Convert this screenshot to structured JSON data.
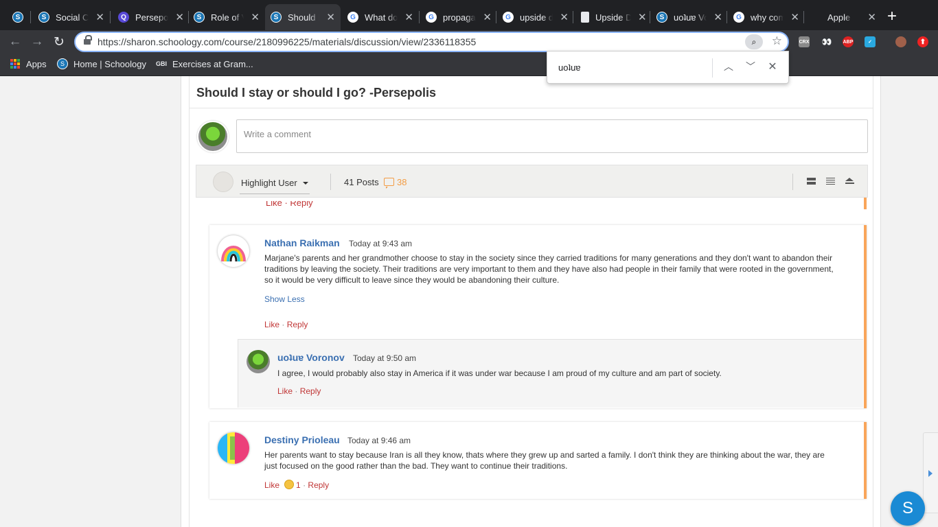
{
  "tabs": [
    {
      "title": "",
      "icon": "schoology-icon"
    },
    {
      "title": "Social Ci",
      "icon": "schoology-icon"
    },
    {
      "title": "Persepol",
      "icon": "quizlet-icon"
    },
    {
      "title": "Role of V",
      "icon": "schoology-icon"
    },
    {
      "title": "Should I",
      "icon": "schoology-icon",
      "active": true
    },
    {
      "title": "What do",
      "icon": "google-icon"
    },
    {
      "title": "propaga",
      "icon": "google-icon"
    },
    {
      "title": "upside d",
      "icon": "google-icon"
    },
    {
      "title": "Upside D",
      "icon": "document-icon"
    },
    {
      "title": "uoʇuɐ Vo",
      "icon": "schoology-icon"
    },
    {
      "title": "why com",
      "icon": "google-icon"
    },
    {
      "title": "Apple",
      "icon": "apple-icon"
    }
  ],
  "toolbar": {
    "url": "https://sharon.schoology.com/course/2180996225/materials/discussion/view/2336118355"
  },
  "bookmarks": [
    {
      "label": "Apps",
      "icon": "apps-grid-icon"
    },
    {
      "label": "Home | Schoology",
      "icon": "schoology-icon"
    },
    {
      "label": "Exercises at Gram...",
      "icon": "gbi-icon"
    }
  ],
  "findbar": {
    "query": "uoʇuɐ"
  },
  "discussion": {
    "title": "Should I stay or should I go? -Persepolis",
    "comment_placeholder": "Write a comment",
    "highlight_user": "Highlight User",
    "posts_count": "41 Posts",
    "comments_count": "38",
    "prev_actions": "Like · Reply"
  },
  "posts": [
    {
      "author": "Nathan Raikman",
      "time": "Today at 9:43 am",
      "body": "Marjane's parents and her grandmother choose to stay in the society since they carried traditions for many generations and they don't want to abandon their traditions by leaving the society. Their traditions are very important to them and they have also had people in their family that were rooted in the government, so it would be very difficult to leave since they would be abandoning their culture.",
      "show_less": "Show Less",
      "like": "Like",
      "reply": "Reply",
      "reply_post": {
        "author": "uoʇuɐ Voronov",
        "time": "Today at 9:50 am",
        "body": "I agree, I would probably also stay in America if it was under war because I am proud of my culture and am part of society.",
        "like": "Like",
        "reply": "Reply"
      }
    },
    {
      "author": "Destiny Prioleau",
      "time": "Today at 9:46 am",
      "body": "Her parents want to stay because Iran is all they know, thats where they grew up and sarted a family. I don't think they are thinking about the war, they are just focused on the good rather than the bad. They want to continue their traditions.",
      "like": "Like",
      "like_count": "1",
      "reply": "Reply"
    }
  ],
  "fab_label": "S",
  "colors": {
    "accent": "#3a6fb1",
    "like": "#c03535",
    "orange": "#f9a55a"
  }
}
